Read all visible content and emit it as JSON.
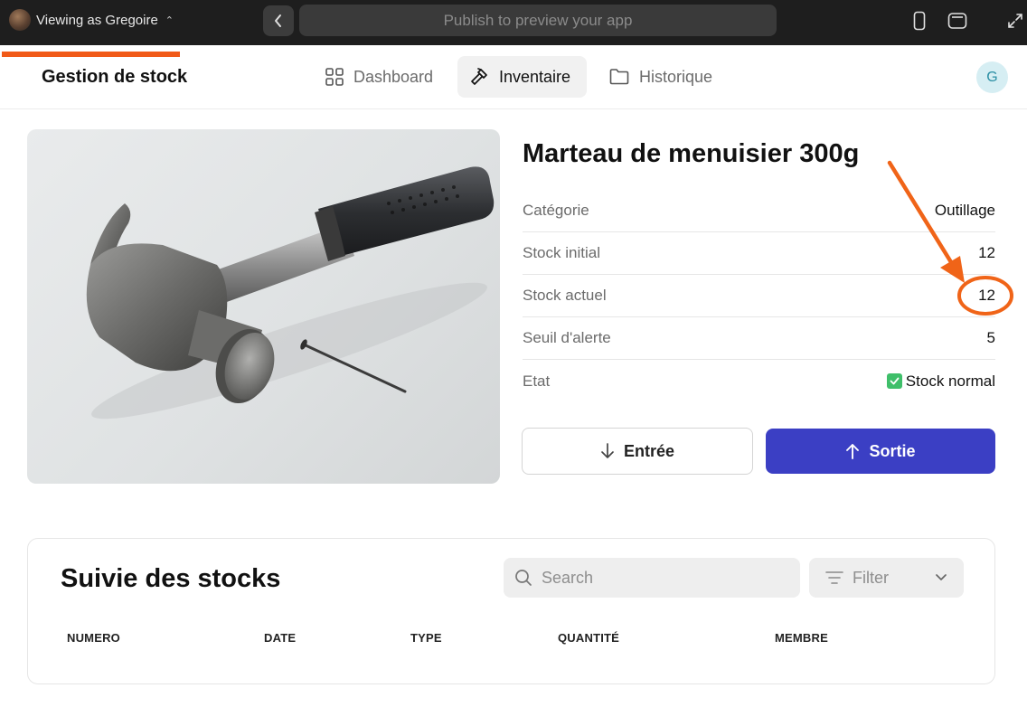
{
  "topbar": {
    "viewer_label": "Viewing as Gregoire",
    "url_placeholder": "Publish to preview your app"
  },
  "nav": {
    "brand": "Gestion de stock",
    "items": [
      {
        "label": "Dashboard",
        "icon": "grid-icon"
      },
      {
        "label": "Inventaire",
        "icon": "hammer-icon",
        "active": true
      },
      {
        "label": "Historique",
        "icon": "folder-icon"
      }
    ],
    "user_initial": "G"
  },
  "product": {
    "title": "Marteau de menuisier 300g",
    "specs": [
      {
        "label": "Catégorie",
        "value": "Outillage"
      },
      {
        "label": "Stock initial",
        "value": "12"
      },
      {
        "label": "Stock actuel",
        "value": "12"
      },
      {
        "label": "Seuil d'alerte",
        "value": "5"
      },
      {
        "label": "Etat",
        "value": "Stock normal"
      }
    ],
    "entree_label": "Entrée",
    "sortie_label": "Sortie"
  },
  "stock_table": {
    "title": "Suivie des stocks",
    "search_placeholder": "Search",
    "filter_label": "Filter",
    "columns": [
      "NUMERO",
      "DATE",
      "TYPE",
      "QUANTITÉ",
      "MEMBRE"
    ]
  },
  "colors": {
    "accent_primary": "#3b3fc4",
    "annotation": "#f06418",
    "status_ok": "#3fbf6a"
  }
}
